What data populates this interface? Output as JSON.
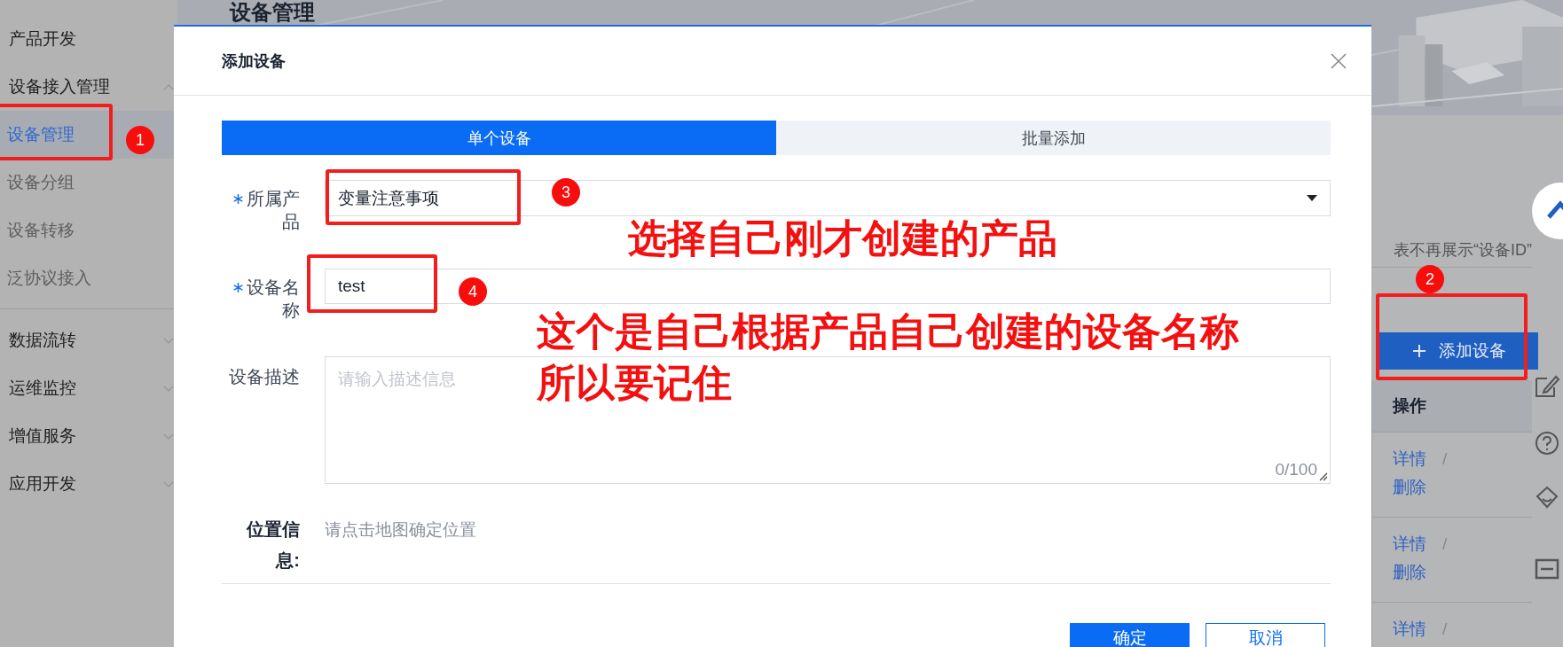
{
  "sidebar": {
    "items": [
      {
        "label": "产品开发"
      },
      {
        "label": "设备接入管理",
        "expanded": true,
        "children": [
          {
            "label": "设备管理",
            "selected": true
          },
          {
            "label": "设备分组",
            "selected": false
          },
          {
            "label": "设备转移",
            "selected": false
          },
          {
            "label": "泛协议接入",
            "selected": false
          }
        ]
      },
      {
        "label": "数据流转",
        "expanded": false
      },
      {
        "label": "运维监控",
        "expanded": false
      },
      {
        "label": "增值服务",
        "expanded": false
      },
      {
        "label": "应用开发",
        "expanded": false
      }
    ]
  },
  "page": {
    "title": "设备管理",
    "notice": "表不再展示“设备ID”",
    "add_button": "添加设备",
    "table": {
      "header": "操作",
      "separator": "/",
      "rows": [
        {
          "actions": [
            "详情",
            "删除"
          ]
        },
        {
          "actions": [
            "详情",
            "删除"
          ]
        },
        {
          "actions": [
            "详情"
          ]
        }
      ]
    }
  },
  "modal": {
    "title": "添加设备",
    "tabs": [
      {
        "label": "单个设备",
        "selected": true
      },
      {
        "label": "批量添加",
        "selected": false
      }
    ],
    "fields": [
      {
        "kind": "select",
        "label": "所属产品",
        "required": true,
        "value": "变量注意事项"
      },
      {
        "kind": "input",
        "label": "设备名称",
        "required": true,
        "value": "test"
      },
      {
        "kind": "textarea",
        "label": "设备描述",
        "required": false,
        "placeholder": "请输入描述信息",
        "counter": "0/100"
      },
      {
        "kind": "location",
        "label": "位置信息:",
        "required": false,
        "hint": "请点击地图确定位置"
      }
    ],
    "buttons": [
      {
        "label": "确定",
        "kind": "primary"
      },
      {
        "label": "取消",
        "kind": "secondary"
      }
    ]
  },
  "annotations": {
    "markers": [
      "1",
      "2",
      "3",
      "4"
    ],
    "notes": [
      "选择自己刚才创建的产品",
      "这个是自己根据产品自己创建的设备名称",
      "所以要记住"
    ]
  }
}
